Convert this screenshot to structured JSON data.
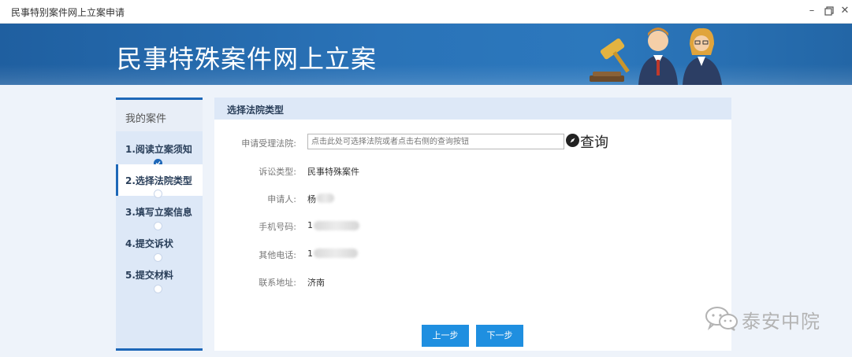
{
  "window": {
    "title": "民事特别案件网上立案申请"
  },
  "banner": {
    "title": "民事特殊案件网上立案"
  },
  "sidebar": {
    "header": "我的案件",
    "steps": [
      {
        "label": "1.阅读立案须知",
        "status": "done"
      },
      {
        "label": "2.选择法院类型",
        "status": "active"
      },
      {
        "label": "3.填写立案信息",
        "status": "pending"
      },
      {
        "label": "4.提交诉状",
        "status": "pending"
      },
      {
        "label": "5.提交材料",
        "status": "pending"
      }
    ]
  },
  "form": {
    "section_title": "选择法院类型",
    "court": {
      "label": "申请受理法院:",
      "placeholder": "点击此处可选择法院或者点击右侧的查询按钮",
      "value": ""
    },
    "query_button": "查询",
    "case_type": {
      "label": "诉讼类型:",
      "value": "民事特殊案件"
    },
    "applicant": {
      "label": "申请人:",
      "value": "杨"
    },
    "mobile": {
      "label": "手机号码:",
      "value": "1"
    },
    "other_phone": {
      "label": "其他电话:",
      "value": "1"
    },
    "address": {
      "label": "联系地址:",
      "value": "济南"
    }
  },
  "buttons": {
    "prev": "上一步",
    "next": "下一步"
  },
  "watermark": {
    "text": "泰安中院"
  },
  "icons": [
    "minimize-icon",
    "maximize-icon",
    "close-icon",
    "check-icon",
    "compass-icon",
    "wechat-icon"
  ],
  "colors": {
    "banner": "#2a73b8",
    "accent": "#1d67b8",
    "button": "#1f8fe0",
    "sidebar": "#dde8f7"
  }
}
